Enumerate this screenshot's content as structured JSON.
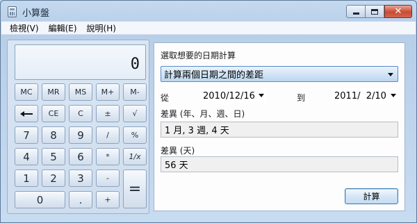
{
  "window": {
    "title": "小算盤"
  },
  "menu": {
    "items": [
      "檢視(V)",
      "編輯(E)",
      "說明(H)"
    ]
  },
  "calculator": {
    "display": "0",
    "memory_keys": [
      "MC",
      "MR",
      "MS",
      "M+",
      "M-"
    ],
    "row2": [
      "CE",
      "C",
      "±",
      "√"
    ],
    "row3": [
      "7",
      "8",
      "9",
      "/",
      "%"
    ],
    "row4": [
      "4",
      "5",
      "6",
      "*",
      "1/x"
    ],
    "row5": [
      "1",
      "2",
      "3",
      "-"
    ],
    "row6": [
      "0",
      ".",
      "+"
    ],
    "equals": "="
  },
  "date_panel": {
    "heading": "選取想要的日期計算",
    "mode": "計算兩個日期之間的差距",
    "from_label": "從",
    "from_date": "2010/12/16",
    "to_label": "到",
    "to_date": "2011/  2/10",
    "diff_label": "差異 (年、月、週、日)",
    "diff_value": "1 月, 3 週, 4 天",
    "days_label": "差異 (天)",
    "days_value": "56 天",
    "calculate_label": "計算"
  }
}
